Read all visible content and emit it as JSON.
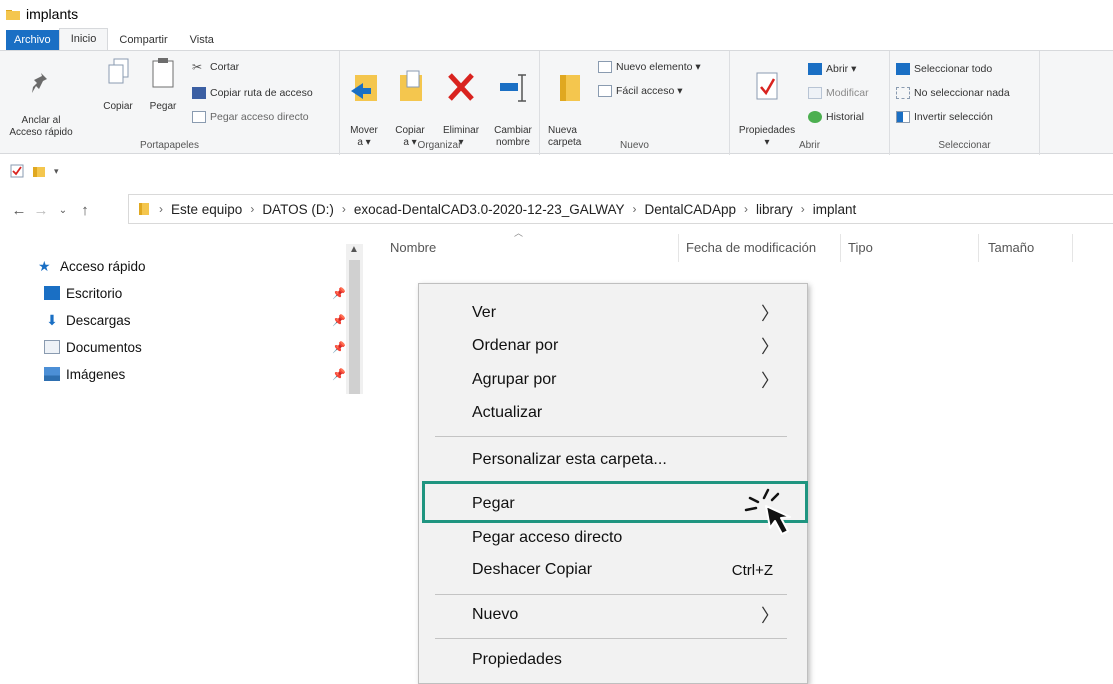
{
  "window": {
    "title": "implants"
  },
  "ribbon_tabs": [
    "Archivo",
    "Inicio",
    "Compartir",
    "Vista"
  ],
  "ribbon": {
    "portapapeles": {
      "label": "Portapapeles",
      "anclar": "Anclar al\nAcceso rápido",
      "copiar": "Copiar",
      "pegar": "Pegar",
      "cortar": "Cortar",
      "copiar_ruta": "Copiar ruta de acceso",
      "pegar_acceso": "Pegar acceso directo"
    },
    "organizar": {
      "label": "Organizar",
      "mover": "Mover\na ▾",
      "copiar_a": "Copiar\na ▾",
      "eliminar": "Eliminar\n▾",
      "cambiar": "Cambiar\nnombre"
    },
    "nuevo": {
      "label": "Nuevo",
      "nueva_carpeta": "Nueva\ncarpeta",
      "nuevo_elemento": "Nuevo elemento ▾",
      "facil_acceso": "Fácil acceso ▾"
    },
    "abrir": {
      "label": "Abrir",
      "propiedades": "Propiedades\n▾",
      "abrir": "Abrir ▾",
      "modificar": "Modificar",
      "historial": "Historial"
    },
    "seleccionar": {
      "label": "Seleccionar",
      "todo": "Seleccionar todo",
      "nada": "No seleccionar nada",
      "invertir": "Invertir selección"
    }
  },
  "address": {
    "crumbs": [
      "Este equipo",
      "DATOS (D:)",
      "exocad-DentalCAD3.0-2020-12-23_GALWAY",
      "DentalCADApp",
      "library",
      "implant"
    ]
  },
  "nav_pane": {
    "quick_access": "Acceso rápido",
    "items": [
      "Escritorio",
      "Descargas",
      "Documentos",
      "Imágenes"
    ]
  },
  "columns": [
    "Nombre",
    "Fecha de modificación",
    "Tipo",
    "Tamaño"
  ],
  "context_menu": {
    "items": [
      {
        "label": "Ver",
        "submenu": true
      },
      {
        "label": "Ordenar por",
        "submenu": true
      },
      {
        "label": "Agrupar por",
        "submenu": true
      },
      {
        "label": "Actualizar"
      },
      {
        "label": "Personalizar esta carpeta..."
      },
      {
        "label": "Pegar"
      },
      {
        "label": "Pegar acceso directo"
      },
      {
        "label": "Deshacer Copiar",
        "shortcut": "Ctrl+Z"
      },
      {
        "label": "Nuevo",
        "submenu": true
      },
      {
        "label": "Propiedades"
      }
    ],
    "highlighted": "Pegar"
  },
  "colors": {
    "accent_file_tab": "#1a6fc4",
    "highlight_border": "#1f9580",
    "folder": "#f4c64e"
  }
}
